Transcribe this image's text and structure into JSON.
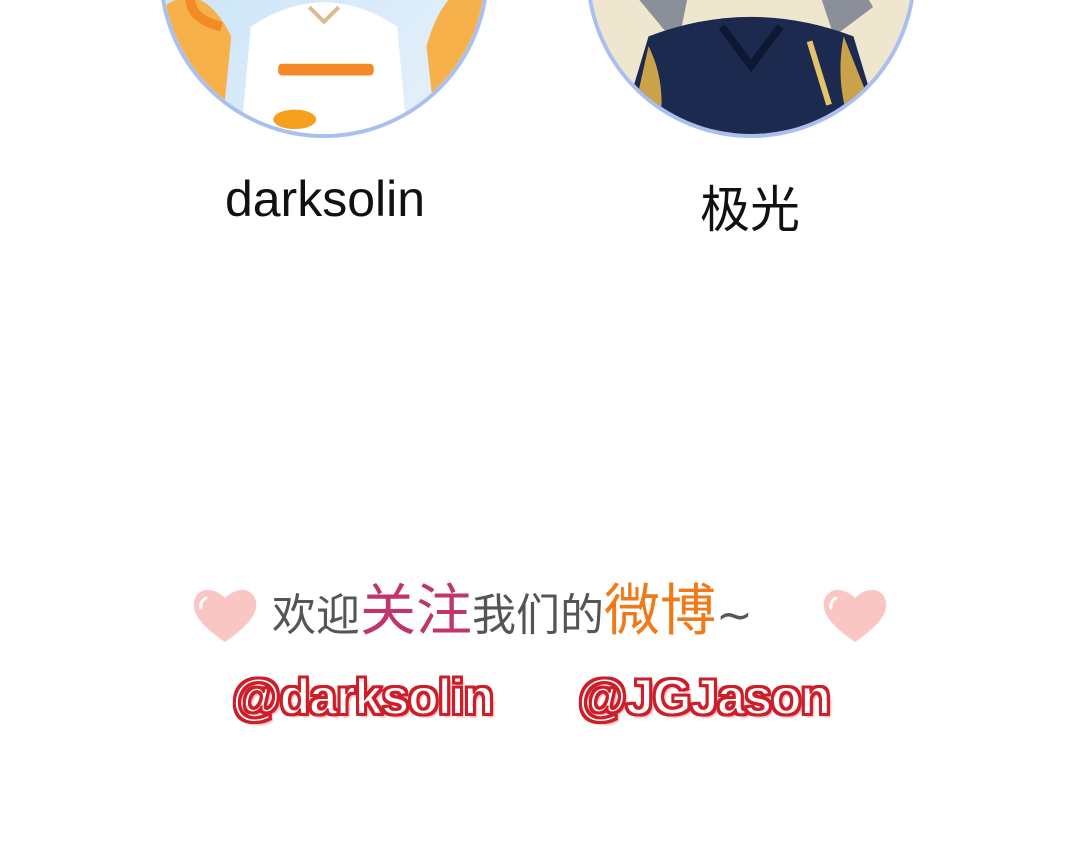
{
  "authors": [
    {
      "name": "darksolin",
      "avatar_icon": "anime-girl-avatar-icon"
    },
    {
      "name": "极光",
      "avatar_icon": "anime-boy-avatar-icon"
    }
  ],
  "footer": {
    "welcome_prefix": "欢迎",
    "welcome_follow": "关注",
    "welcome_middle": "我们的",
    "welcome_weibo": "微博",
    "welcome_suffix": "~",
    "handles": [
      "@darksolin",
      "@JGJason"
    ]
  },
  "colors": {
    "avatar_border": "#a9bff0",
    "follow_text": "#c0356d",
    "weibo_text": "#f07a1a",
    "handle_outline": "#cc1f2a",
    "heart": "#f9c6c4"
  }
}
